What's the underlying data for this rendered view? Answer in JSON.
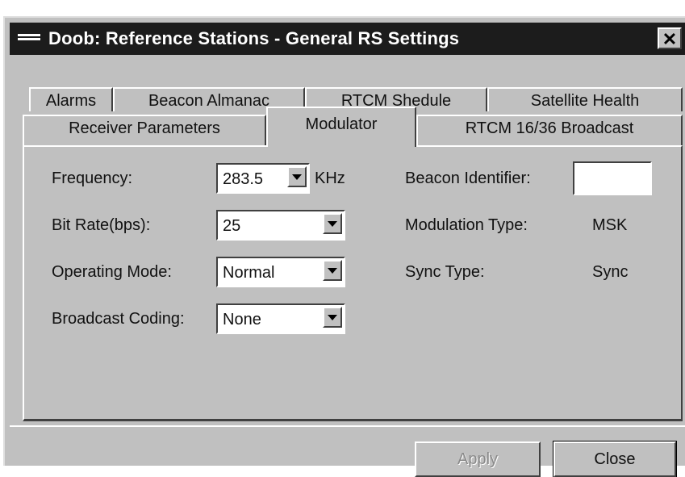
{
  "window": {
    "title": "Doob: Reference Stations - General RS Settings",
    "close_glyph": "✕"
  },
  "tabs": {
    "row1": [
      {
        "label": "Alarms"
      },
      {
        "label": "Beacon Almanac"
      },
      {
        "label": "RTCM Shedule"
      },
      {
        "label": "Satellite Health"
      }
    ],
    "row2": [
      {
        "label": "Receiver Parameters"
      },
      {
        "label": "Modulator",
        "active": true
      },
      {
        "label": "RTCM 16/36 Broadcast"
      }
    ]
  },
  "form": {
    "frequency": {
      "label": "Frequency:",
      "value": "283.5",
      "unit": "KHz"
    },
    "bit_rate": {
      "label": "Bit Rate(bps):",
      "value": "25"
    },
    "operating_mode": {
      "label": "Operating Mode:",
      "value": "Normal"
    },
    "broadcast_coding": {
      "label": "Broadcast Coding:",
      "value": "None"
    },
    "beacon_identifier": {
      "label": "Beacon Identifier:",
      "value": ""
    },
    "modulation_type": {
      "label": "Modulation Type:",
      "value": "MSK"
    },
    "sync_type": {
      "label": "Sync Type:",
      "value": "Sync"
    }
  },
  "buttons": {
    "apply": "Apply",
    "close": "Close"
  },
  "colors": {
    "titlebar": "#1c1c1c",
    "face": "#c0c0c0"
  }
}
